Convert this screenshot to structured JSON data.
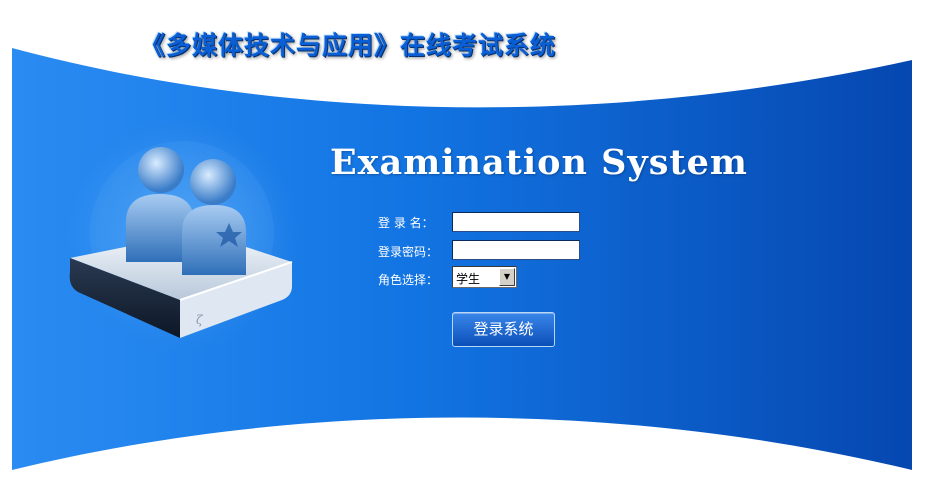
{
  "header": {
    "system_title": "《多媒体技术与应用》在线考试系统"
  },
  "main": {
    "heading": "Examination System",
    "form": {
      "username_label": "登 录 名：",
      "username_value": "",
      "password_label": "登录密码：",
      "password_value": "",
      "role_label": "角色选择：",
      "role_selected": "学生",
      "submit_label": "登录系统"
    }
  },
  "colors": {
    "panel_light": "#2a8cf2",
    "panel_dark": "#0647b0",
    "title_blue": "#0a5fd6",
    "heading_white": "#ffffff"
  },
  "icons": {
    "illustration": "users-on-server-icon",
    "select_arrow": "chevron-down-icon"
  }
}
